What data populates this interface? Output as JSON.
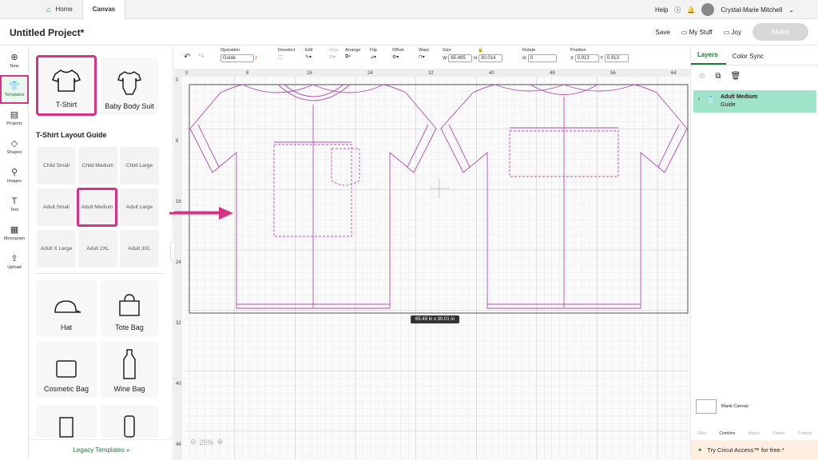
{
  "topbar": {
    "home": "Home",
    "canvas": "Canvas",
    "help": "Help",
    "user": "Crystal-Marie Mitchell"
  },
  "header": {
    "title": "Untitled Project*",
    "save": "Save",
    "my_stuff": "My Stuff",
    "joy": "Joy",
    "make": "Make"
  },
  "rail": [
    {
      "name": "new",
      "label": "New",
      "icon": "⊕"
    },
    {
      "name": "templates",
      "label": "Templates",
      "icon": "👕"
    },
    {
      "name": "projects",
      "label": "Projects",
      "icon": "▤"
    },
    {
      "name": "shapes",
      "label": "Shapes",
      "icon": "◇"
    },
    {
      "name": "images",
      "label": "Images",
      "icon": "⚲"
    },
    {
      "name": "text",
      "label": "Text",
      "icon": "T"
    },
    {
      "name": "monogram",
      "label": "Monogram",
      "icon": "▦"
    },
    {
      "name": "upload",
      "label": "Upload",
      "icon": "⇪"
    }
  ],
  "templates": {
    "tshirt": "T-Shirt",
    "baby": "Baby Body Suit",
    "layout_title": "T-Shirt Layout Guide",
    "sizes": [
      "Child Small",
      "Child Medium",
      "Child Large",
      "Adult Small",
      "Adult Medium",
      "Adult Large",
      "Adult X Large",
      "Adult 2XL",
      "Adult 3XL"
    ],
    "more": [
      "Hat",
      "Tote Bag",
      "Cosmetic Bag",
      "Wine Bag"
    ],
    "legacy": "Legacy Templates  »"
  },
  "toolbar": {
    "operation": "Operation",
    "operation_val": "Guide",
    "deselect": "Deselect",
    "edit": "Edit",
    "align": "Align",
    "arrange": "Arrange",
    "flip": "Flip",
    "offset": "Offset",
    "warp": "Warp",
    "size": "Size",
    "w": "W",
    "w_val": "65.485",
    "h": "H",
    "h_val": "30.014",
    "rotate": "Rotate",
    "rotate_val": "0",
    "position": "Position",
    "x": "X",
    "x_val": "0.913",
    "y": "Y",
    "y_val": "0.913"
  },
  "ruler": {
    "top": [
      "0",
      "8",
      "16",
      "24",
      "32",
      "40",
      "48",
      "56",
      "64"
    ],
    "left": [
      "0",
      "8",
      "16",
      "24",
      "32",
      "40",
      "48"
    ]
  },
  "canvas": {
    "size_badge": "65.49  in x 30.01  in",
    "zoom": "25%"
  },
  "right": {
    "tab_layers": "Layers",
    "tab_color": "Color Sync",
    "layer_name": "Adult Medium",
    "layer_sub": "Guide",
    "blank": "Blank Canvas",
    "tools": [
      "Slice",
      "Combine",
      "Attach",
      "Flatten",
      "Contour"
    ],
    "access": "Try Cricut Access™ for free.*"
  },
  "colors": {
    "accent": "#197a3a",
    "highlight": "#d63384",
    "guide": "#b34fb0"
  }
}
